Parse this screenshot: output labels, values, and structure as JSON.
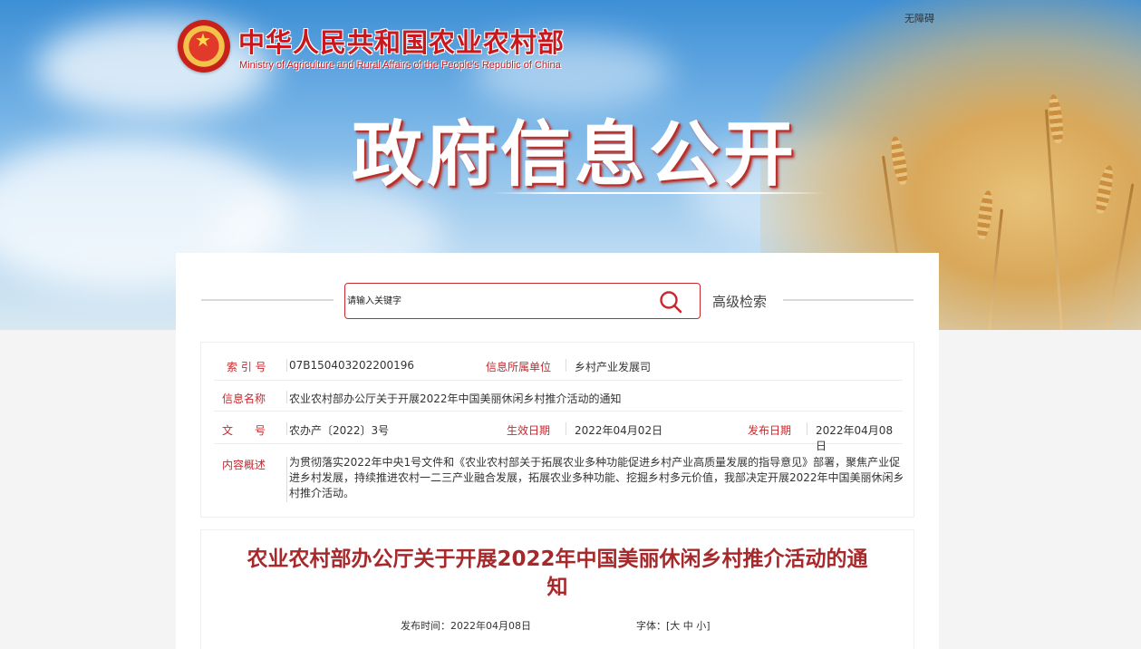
{
  "header": {
    "accessibility_link": "无障碍",
    "ministry_name_cn": "中华人民共和国农业农村部",
    "ministry_name_en": "Ministry of Agriculture and Rural Affairs of the People's Republic of China",
    "section_title": "政府信息公开"
  },
  "search": {
    "placeholder": "请输入关键字",
    "advanced_label": "高级检索"
  },
  "info": {
    "index_label": "索 引 号",
    "index_value": "07B150403202200196",
    "unit_label": "信息所属单位",
    "unit_value": "乡村产业发展司",
    "name_label": "信息名称",
    "name_value": "农业农村部办公厅关于开展2022年中国美丽休闲乡村推介活动的通知",
    "doc_label": "文　　号",
    "doc_value": "农办产〔2022〕3号",
    "effective_label": "生效日期",
    "effective_value": "2022年04月02日",
    "publish_label": "发布日期",
    "publish_value": "2022年04月08日",
    "summary_label": "内容概述",
    "summary_value": "为贯彻落实2022年中央1号文件和《农业农村部关于拓展农业多种功能促进乡村产业高质量发展的指导意见》部署，聚焦产业促进乡村发展，持续推进农村一二三产业融合发展，拓展农业多种功能、挖掘乡村多元价值，我部决定开展2022年中国美丽休闲乡村推介活动。"
  },
  "article": {
    "title": "农业农村部办公厅关于开展2022年中国美丽休闲乡村推介活动的通知",
    "publish_time": "发布时间：2022年04月08日",
    "font_label": "字体：[",
    "font_large": "大",
    "font_medium": "中",
    "font_small": "小",
    "font_close": "]"
  },
  "colors": {
    "brand_red": "#c8181e",
    "label_red": "#c8282e",
    "title_red": "#a8292b"
  }
}
